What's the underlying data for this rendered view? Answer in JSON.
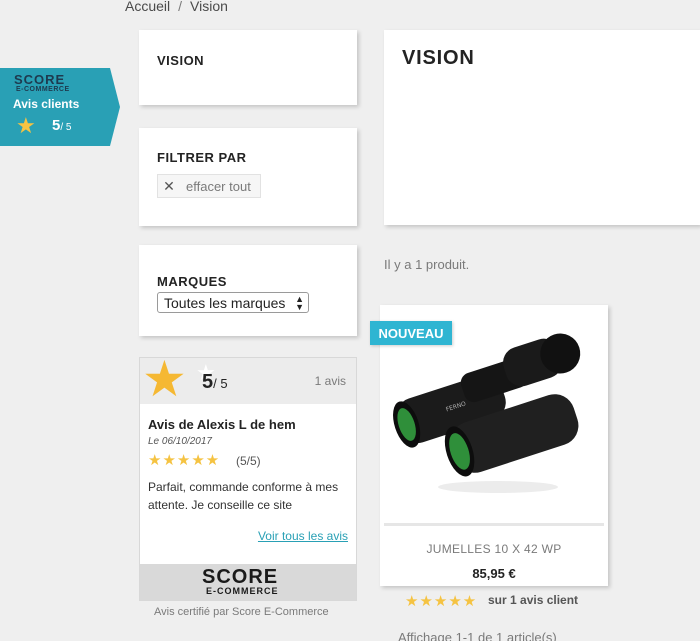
{
  "breadcrumb": {
    "items": [
      "Accueil",
      "Vision"
    ],
    "separator": "/"
  },
  "sidebar": {
    "category_block": {
      "title": "VISION"
    },
    "filter_block": {
      "title": "FILTRER PAR",
      "clear_label": "effacer tout"
    },
    "brands_block": {
      "title": "MARQUES",
      "selected": "Toutes les marques"
    }
  },
  "main": {
    "category_title": "VISION",
    "product_count": "Il y a 1 produit.",
    "pagination": "Affichage 1-1 de 1 article(s)"
  },
  "score_badge": {
    "logo": "SCORE",
    "logo_sub": "E-COMMERCE",
    "label": "Avis clients",
    "score": "5",
    "out_of": "/ 5"
  },
  "review_widget": {
    "rating": "5",
    "out_of": "/ 5",
    "count": "1 avis",
    "author": "Avis de Alexis L de hem",
    "date": "Le 06/10/2017",
    "stars": "★★★★★",
    "note": "(5/5)",
    "comment": "Parfait, commande conforme à mes attente. Je conseille ce site",
    "see_all": "Voir tous les avis",
    "footer_logo": "SCORE",
    "footer_logo_sub": "E-COMMERCE",
    "certified": "Avis certifié par Score E-Commerce"
  },
  "product": {
    "badge": "NOUVEAU",
    "name": "JUMELLES 10 X 42 WP",
    "price": "85,95 €",
    "stars": "★★★★★",
    "rating_label": "sur 1 avis client"
  },
  "colors": {
    "accent": "#2fb5d2",
    "badge_teal": "#29a0b5",
    "star": "#f5c342",
    "background": "#efefef"
  }
}
